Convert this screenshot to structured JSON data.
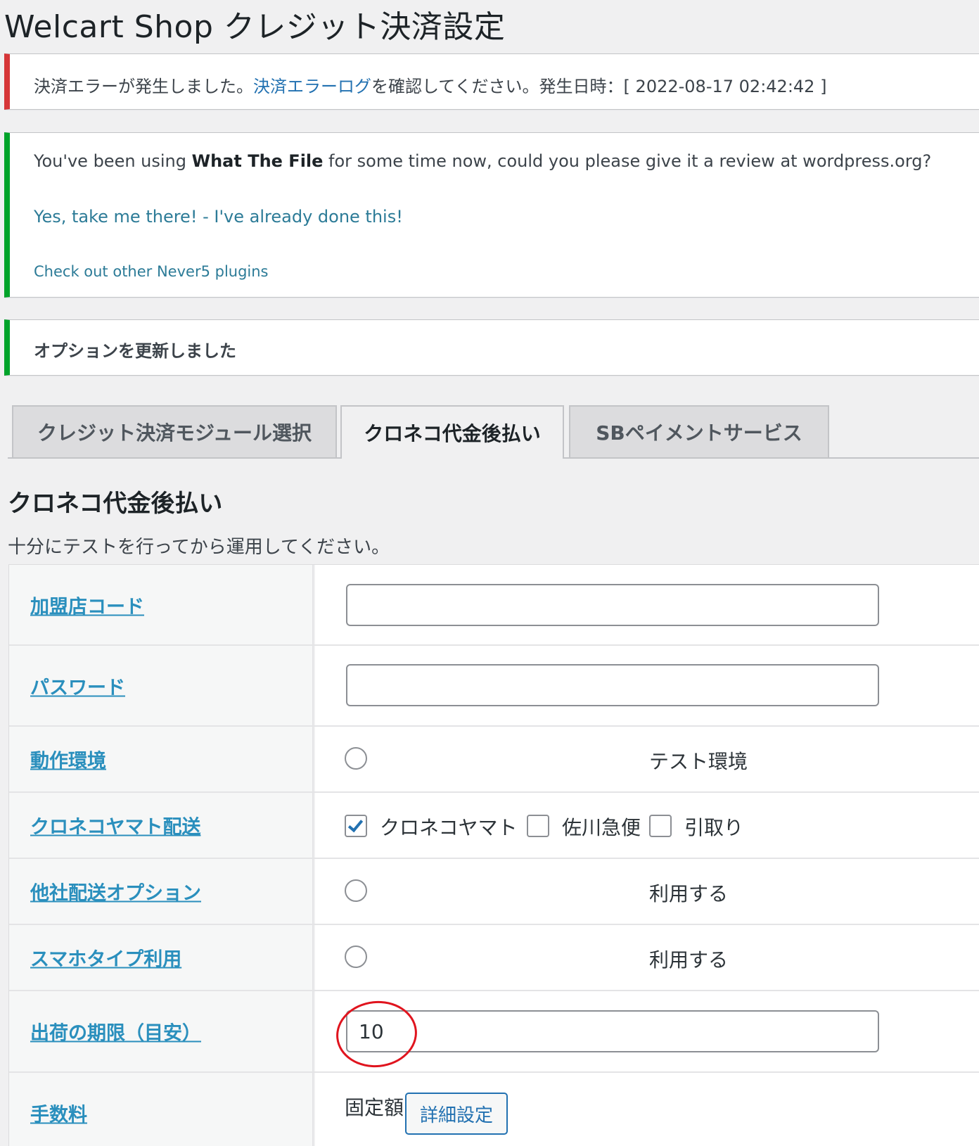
{
  "page": {
    "title": "Welcart Shop クレジット決済設定"
  },
  "notices": {
    "error": {
      "prefix": "決済エラーが発生しました。",
      "link": "決済エラーログ",
      "suffix": "を確認してください。発生日時：[ 2022-08-17 02:42:42 ]"
    },
    "review": {
      "text_before": "You've been using ",
      "plugin_name": "What The File",
      "text_after": " for some time now, could you please give it a review at wordpress.org?",
      "yes_link": "Yes, take me there!",
      "separator": " - ",
      "done_link": "I've already done this!",
      "other_link": "Check out other Never5 plugins"
    },
    "updated": "オプションを更新しました"
  },
  "tabs": [
    {
      "label": "クレジット決済モジュール選択",
      "active": false
    },
    {
      "label": "クロネコ代金後払い",
      "active": true
    },
    {
      "label": "SBペイメントサービス",
      "active": false
    }
  ],
  "section": {
    "title": "クロネコ代金後払い",
    "description": "十分にテストを行ってから運用してください。"
  },
  "form": {
    "merchant_code": {
      "label": "加盟店コード",
      "value": ""
    },
    "password": {
      "label": "パスワード",
      "value": ""
    },
    "environment": {
      "label": "動作環境",
      "option": "テスト環境",
      "checked": false
    },
    "yamato_delivery": {
      "label": "クロネコヤマト配送",
      "options": [
        {
          "label": "クロネコヤマト",
          "checked": true
        },
        {
          "label": "佐川急便",
          "checked": false
        },
        {
          "label": "引取り",
          "checked": false
        }
      ]
    },
    "other_delivery": {
      "label": "他社配送オプション",
      "option": "利用する",
      "checked": false
    },
    "smartphone": {
      "label": "スマホタイプ利用",
      "option": "利用する",
      "checked": false
    },
    "shipping_deadline": {
      "label": "出荷の期限（目安）",
      "value": "10"
    },
    "fee": {
      "label": "手数料",
      "type_text": "固定額",
      "button": "詳細設定"
    }
  },
  "colors": {
    "error_border": "#d63638",
    "success_border": "#00a32a",
    "link": "#2271b1",
    "annotation_circle": "#e0141e"
  }
}
